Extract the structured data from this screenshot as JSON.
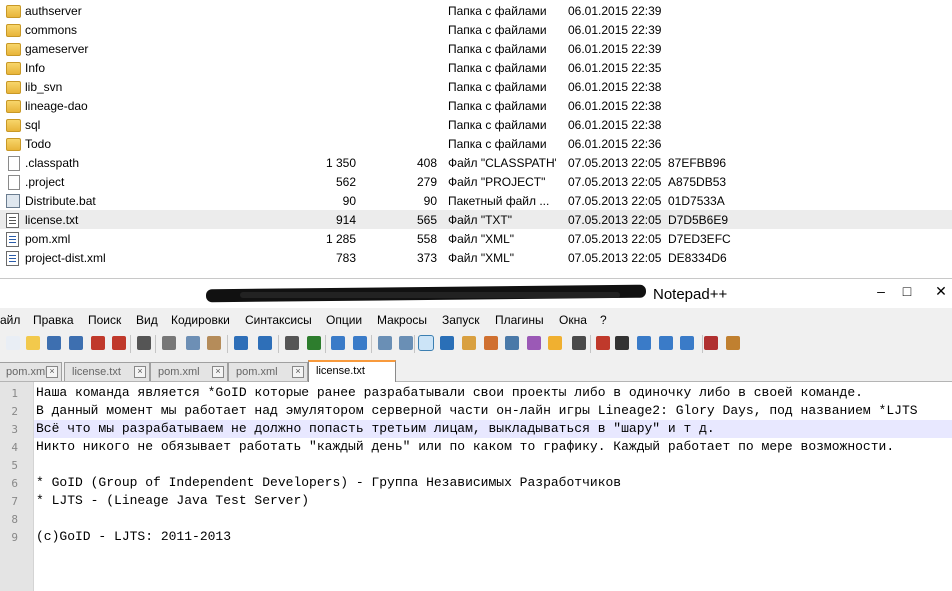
{
  "files": [
    {
      "name": "authserver",
      "size": "",
      "packed": "",
      "type": "Папка с файлами",
      "date": "06.01.2015 22:39",
      "crc": "",
      "icon": "folder-icon"
    },
    {
      "name": "commons",
      "size": "",
      "packed": "",
      "type": "Папка с файлами",
      "date": "06.01.2015 22:39",
      "crc": "",
      "icon": "folder-icon"
    },
    {
      "name": "gameserver",
      "size": "",
      "packed": "",
      "type": "Папка с файлами",
      "date": "06.01.2015 22:39",
      "crc": "",
      "icon": "folder-icon"
    },
    {
      "name": "Info",
      "size": "",
      "packed": "",
      "type": "Папка с файлами",
      "date": "06.01.2015 22:35",
      "crc": "",
      "icon": "folder-icon"
    },
    {
      "name": "lib_svn",
      "size": "",
      "packed": "",
      "type": "Папка с файлами",
      "date": "06.01.2015 22:38",
      "crc": "",
      "icon": "folder-icon"
    },
    {
      "name": "lineage-dao",
      "size": "",
      "packed": "",
      "type": "Папка с файлами",
      "date": "06.01.2015 22:38",
      "crc": "",
      "icon": "folder-icon"
    },
    {
      "name": "sql",
      "size": "",
      "packed": "",
      "type": "Папка с файлами",
      "date": "06.01.2015 22:38",
      "crc": "",
      "icon": "folder-icon"
    },
    {
      "name": "Todo",
      "size": "",
      "packed": "",
      "type": "Папка с файлами",
      "date": "06.01.2015 22:36",
      "crc": "",
      "icon": "folder-icon"
    },
    {
      "name": ".classpath",
      "size": "1 350",
      "packed": "408",
      "type": "Файл \"CLASSPATH\"",
      "date": "07.05.2013 22:05",
      "crc": "87EFBB96",
      "icon": "file-icon"
    },
    {
      "name": ".project",
      "size": "562",
      "packed": "279",
      "type": "Файл \"PROJECT\"",
      "date": "07.05.2013 22:05",
      "crc": "A875DB53",
      "icon": "file-icon"
    },
    {
      "name": "Distribute.bat",
      "size": "90",
      "packed": "90",
      "type": "Пакетный файл ...",
      "date": "07.05.2013 22:05",
      "crc": "01D7533A",
      "icon": "batch-file-icon"
    },
    {
      "name": "license.txt",
      "size": "914",
      "packed": "565",
      "type": "Файл \"TXT\"",
      "date": "07.05.2013 22:05",
      "crc": "D7D5B6E9",
      "icon": "text-file-icon"
    },
    {
      "name": "pom.xml",
      "size": "1 285",
      "packed": "558",
      "type": "Файл \"XML\"",
      "date": "07.05.2013 22:05",
      "crc": "D7ED3EFC",
      "icon": "xml-file-icon"
    },
    {
      "name": "project-dist.xml",
      "size": "783",
      "packed": "373",
      "type": "Файл \"XML\"",
      "date": "07.05.2013 22:05",
      "crc": "DE8334D6",
      "icon": "xml-file-icon"
    }
  ],
  "npp": {
    "title": "Notepad++",
    "window_buttons": {
      "minimize": "–",
      "maximize": "□",
      "close": "✕"
    },
    "menu": [
      "айл",
      "Правка",
      "Поиск",
      "Вид",
      "Кодировки",
      "Синтаксисы",
      "Опции",
      "Макросы",
      "Запуск",
      "Плагины",
      "Окна",
      "?"
    ],
    "tabs": [
      {
        "label": "pom.xml",
        "active": false
      },
      {
        "label": "license.txt",
        "active": false
      },
      {
        "label": "pom.xml",
        "active": false
      },
      {
        "label": "pom.xml",
        "active": false
      },
      {
        "label": "license.txt",
        "active": true
      }
    ],
    "lines": [
      "Наша команда является *GoID которые ранее разрабатывали свои проекты либо в одиночку либо в своей команде.",
      "В данный момент мы работает над эмулятором серверной части он-лайн игры Lineage2: Glory Days, под названием *LJTS",
      "Всё что мы разрабатываем не должно попасть третьим лицам, выкладываться в \"шару\" и т д.",
      "Никто никого не обязывает работать \"каждый день\" или по каком то графику. Каждый работает по мере возможности.",
      "",
      "* GoID (Group of Independent Developers) - Группа Независимых Разработчиков",
      "* LJTS - (Lineage Java Test Server)",
      "",
      "(c)GoID - LJTS: 2011-2013"
    ],
    "line_numbers": [
      "1",
      "2",
      "3",
      "4",
      "5",
      "6",
      "7",
      "8",
      "9"
    ],
    "current_line": 3,
    "toolbar_icons": [
      "new-file-icon",
      "open-file-icon",
      "save-icon",
      "save-all-icon",
      "close-icon",
      "close-all-icon",
      "print-icon",
      "cut-icon",
      "copy-icon",
      "paste-icon",
      "undo-icon",
      "redo-icon",
      "find-icon",
      "replace-icon",
      "zoom-in-icon",
      "zoom-out-icon",
      "sync-vertical-icon",
      "sync-horizontal-icon",
      "word-wrap-icon",
      "show-all-chars-icon",
      "indent-guide-icon",
      "user-lang-icon",
      "doc-map-icon",
      "function-list-icon",
      "folder-workspace-icon",
      "monitor-icon",
      "record-macro-icon",
      "stop-macro-icon",
      "play-macro-icon",
      "run-macro-multiple-icon",
      "save-macro-icon",
      "spell-check-icon",
      "spell-check-settings-icon"
    ]
  }
}
